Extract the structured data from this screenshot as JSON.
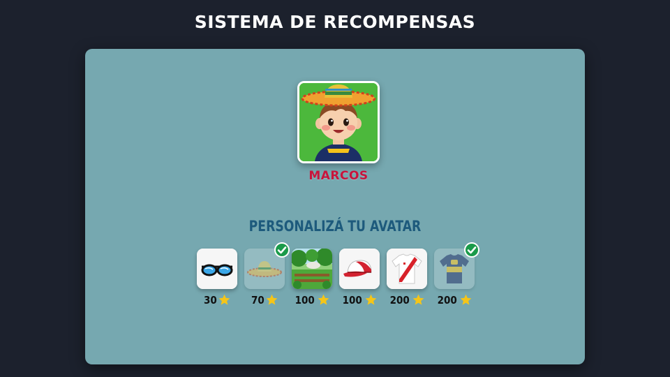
{
  "header": {
    "title": "SISTEMA DE RECOMPENSAS"
  },
  "avatar": {
    "name": "MARCOS"
  },
  "customize": {
    "title": "PERSONALIZÁ TU AVATAR",
    "items": [
      {
        "icon": "sunglasses-icon",
        "price": "30",
        "owned": false
      },
      {
        "icon": "sombrero-icon",
        "price": "70",
        "owned": true
      },
      {
        "icon": "park-background-icon",
        "price": "100",
        "owned": false
      },
      {
        "icon": "cap-icon",
        "price": "100",
        "owned": false
      },
      {
        "icon": "river-jersey-icon",
        "price": "200",
        "owned": false
      },
      {
        "icon": "boca-jersey-icon",
        "price": "200",
        "owned": true
      }
    ]
  },
  "colors": {
    "background": "#1c212d",
    "panel": "#76a8b0",
    "name": "#c8143c",
    "section_title": "#1d5a7c",
    "check": "#1a9a4a",
    "star": "#f5c518"
  }
}
